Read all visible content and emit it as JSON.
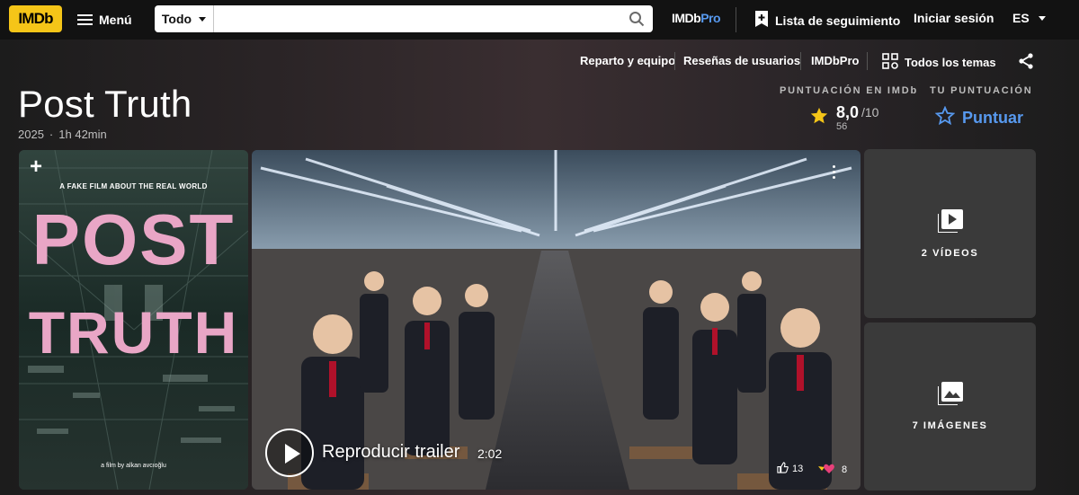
{
  "nav": {
    "logo_text": "IMDb",
    "menu_label": "Menú",
    "search": {
      "category": "Todo",
      "value": "",
      "placeholder": ""
    },
    "imdbpro_label_a": "IMDb",
    "imdbpro_label_b": "Pro",
    "watchlist_label": "Lista de seguimiento",
    "signin_label": "Iniciar sesión",
    "language": "ES"
  },
  "subnav": {
    "items": [
      {
        "label": "Reparto y equipo"
      },
      {
        "label": "Reseñas de usuarios"
      },
      {
        "label": "IMDbPro"
      },
      {
        "label": "Todos los temas"
      }
    ]
  },
  "title": {
    "name": "Post Truth",
    "year": "2025",
    "separator": "·",
    "runtime": "1h 42min"
  },
  "rating": {
    "imdb_label": "PUNTUACIÓN EN IMDb",
    "score": "8,0",
    "max": "/10",
    "votes": "56",
    "user_label": "TU PUNTUACIÓN",
    "rate_label": "Puntuar"
  },
  "poster": {
    "tagline": "A FAKE FILM ABOUT THE REAL WORLD",
    "word1": "POST",
    "word2": "TRUTH",
    "credit": "a film by alkan avcıoğlu"
  },
  "video": {
    "play_label": "Reproducir trailer",
    "duration": "2:02",
    "likes": "13",
    "reactions": "8"
  },
  "media": {
    "videos_label": "2 VÍDEOS",
    "images_label": "7 IMÁGENES"
  },
  "colors": {
    "brand": "#f5c518",
    "accent": "#5799ef",
    "poster_text": "#e9a6c6"
  }
}
